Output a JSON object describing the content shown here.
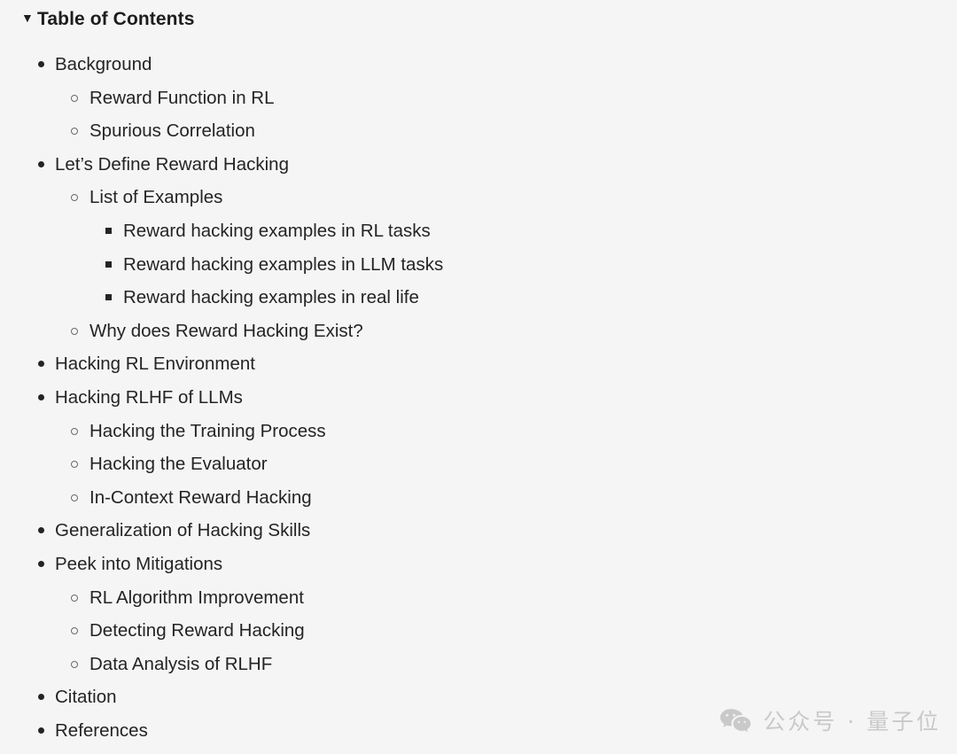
{
  "header": {
    "caret": "▼",
    "title": "Table of Contents"
  },
  "toc": {
    "items": [
      {
        "level": 1,
        "marker": "disc",
        "label": "Background"
      },
      {
        "level": 2,
        "marker": "circle",
        "label": "Reward Function in RL"
      },
      {
        "level": 2,
        "marker": "circle",
        "label": "Spurious Correlation"
      },
      {
        "level": 1,
        "marker": "disc",
        "label": "Let’s Define Reward Hacking"
      },
      {
        "level": 2,
        "marker": "circle",
        "label": "List of Examples"
      },
      {
        "level": 3,
        "marker": "square",
        "label": "Reward hacking examples in RL tasks"
      },
      {
        "level": 3,
        "marker": "square",
        "label": "Reward hacking examples in LLM tasks"
      },
      {
        "level": 3,
        "marker": "square",
        "label": "Reward hacking examples in real life"
      },
      {
        "level": 2,
        "marker": "circle",
        "label": "Why does Reward Hacking Exist?"
      },
      {
        "level": 1,
        "marker": "disc",
        "label": "Hacking RL Environment"
      },
      {
        "level": 1,
        "marker": "disc",
        "label": "Hacking RLHF of LLMs"
      },
      {
        "level": 2,
        "marker": "circle",
        "label": "Hacking the Training Process"
      },
      {
        "level": 2,
        "marker": "circle",
        "label": "Hacking the Evaluator"
      },
      {
        "level": 2,
        "marker": "circle",
        "label": "In-Context Reward Hacking"
      },
      {
        "level": 1,
        "marker": "disc",
        "label": "Generalization of Hacking Skills"
      },
      {
        "level": 1,
        "marker": "disc",
        "label": "Peek into Mitigations"
      },
      {
        "level": 2,
        "marker": "circle",
        "label": "RL Algorithm Improvement"
      },
      {
        "level": 2,
        "marker": "circle",
        "label": "Detecting Reward Hacking"
      },
      {
        "level": 2,
        "marker": "circle",
        "label": "Data Analysis of RLHF"
      },
      {
        "level": 1,
        "marker": "disc",
        "label": "Citation"
      },
      {
        "level": 1,
        "marker": "disc",
        "label": "References"
      }
    ]
  },
  "watermark": {
    "icon": "wechat-icon",
    "text": "公众号 · 量子位",
    "color": "#c9c9c9"
  },
  "colors": {
    "background": "#f5f5f5",
    "text": "#242424",
    "heading": "#1d1d1d",
    "watermark": "#c9c9c9"
  }
}
